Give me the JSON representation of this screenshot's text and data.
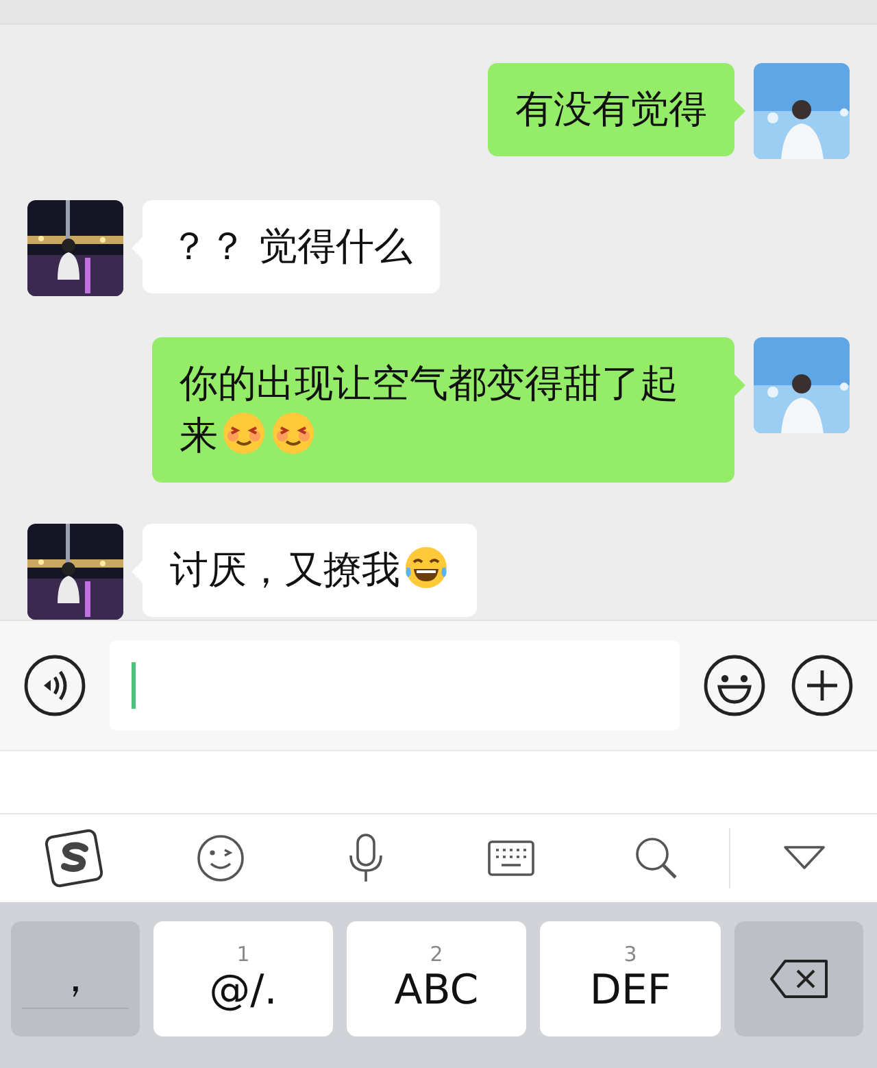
{
  "messages": [
    {
      "kind": "sent",
      "text": "有没有觉得"
    },
    {
      "kind": "received",
      "text": "？？ 觉得什么"
    },
    {
      "kind": "sent",
      "text": "你的出现让空气都变得甜了起来",
      "emojis": [
        {
          "kind": "smitten"
        },
        {
          "kind": "smitten"
        }
      ]
    },
    {
      "kind": "received",
      "text": "讨厌，又撩我",
      "emojis": [
        {
          "kind": "tears-of-joy"
        }
      ]
    }
  ],
  "keyboard": {
    "keys": [
      {
        "kind": "symbol",
        "label": "，"
      },
      {
        "kind": "letter",
        "number": "1",
        "label": "@/."
      },
      {
        "kind": "letter",
        "number": "2",
        "label": "ABC"
      },
      {
        "kind": "letter",
        "number": "3",
        "label": "DEF"
      },
      {
        "kind": "delete"
      }
    ]
  }
}
